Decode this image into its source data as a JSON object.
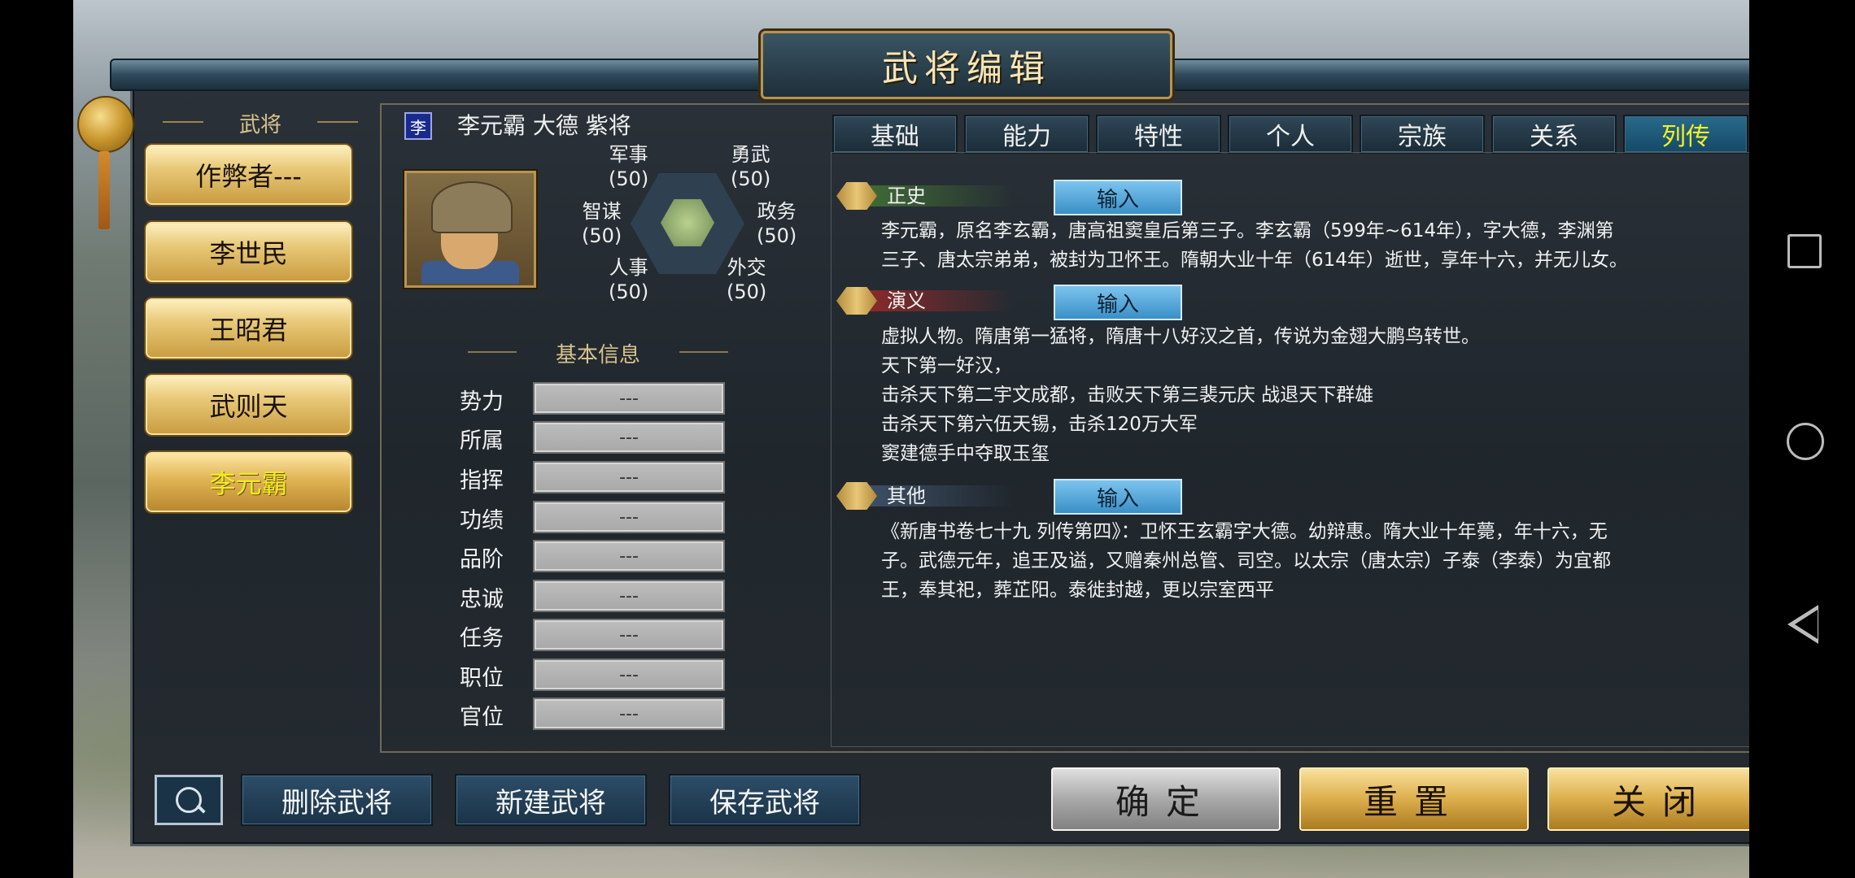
{
  "header": {
    "title": "武将编辑"
  },
  "list": {
    "title": "武将",
    "items": [
      "作弊者---",
      "李世民",
      "王昭君",
      "武则天",
      "李元霸"
    ],
    "selected_index": 4
  },
  "character": {
    "badge": "李",
    "name_line": "李元霸  大德  紫将",
    "stats": {
      "military": {
        "label": "军事",
        "value": "(50)"
      },
      "valor": {
        "label": "勇武",
        "value": "(50)"
      },
      "strategy": {
        "label": "智谋",
        "value": "(50)"
      },
      "politics": {
        "label": "政务",
        "value": "(50)"
      },
      "personnel": {
        "label": "人事",
        "value": "(50)"
      },
      "diplomacy": {
        "label": "外交",
        "value": "(50)"
      }
    }
  },
  "basic_info": {
    "title": "基本信息",
    "rows": [
      {
        "label": "势力",
        "value": "---"
      },
      {
        "label": "所属",
        "value": "---"
      },
      {
        "label": "指挥",
        "value": "---"
      },
      {
        "label": "功绩",
        "value": "---"
      },
      {
        "label": "品阶",
        "value": "---"
      },
      {
        "label": "忠诚",
        "value": "---"
      },
      {
        "label": "任务",
        "value": "---"
      },
      {
        "label": "职位",
        "value": "---"
      },
      {
        "label": "官位",
        "value": "---"
      }
    ]
  },
  "tabs": [
    "基础",
    "能力",
    "特性",
    "个人",
    "宗族",
    "关系",
    "列传"
  ],
  "active_tab": 6,
  "sections": {
    "official": {
      "label": "正史",
      "input": "输入",
      "lines": [
        "李元霸，原名李玄霸，唐高祖窦皇后第三子。李玄霸（599年~614年），字大德，李渊第",
        "三子、唐太宗弟弟，被封为卫怀王。隋朝大业十年（614年）逝世，享年十六，并无儿女。"
      ]
    },
    "romance": {
      "label": "演义",
      "input": "输入",
      "lines": [
        "虚拟人物。隋唐第一猛将，隋唐十八好汉之首，传说为金翅大鹏鸟转世。",
        "天下第一好汉，",
        "击杀天下第二宇文成都，击败天下第三裴元庆 战退天下群雄",
        "击杀天下第六伍天锡，击杀120万大军",
        "窦建德手中夺取玉玺"
      ]
    },
    "other": {
      "label": "其他",
      "input": "输入",
      "lines": [
        "《新唐书卷七十九 列传第四》：卫怀王玄霸字大德。幼辩惠。隋大业十年薨，年十六，无",
        "子。武德元年，追王及谥，又赠秦州总管、司空。以太宗（唐太宗）子泰（李泰）为宜都",
        "王，奉其祀，葬芷阳。泰徙封越，更以宗室西平"
      ]
    }
  },
  "bottom": {
    "delete": "删除武将",
    "create": "新建武将",
    "save": "保存武将",
    "confirm": "确定",
    "reset": "重置",
    "close": "关闭"
  },
  "colors": {
    "accent_gold": "#e8c877",
    "active_tab_text": "#f8f024",
    "input_blue": "#3a8fc6"
  }
}
